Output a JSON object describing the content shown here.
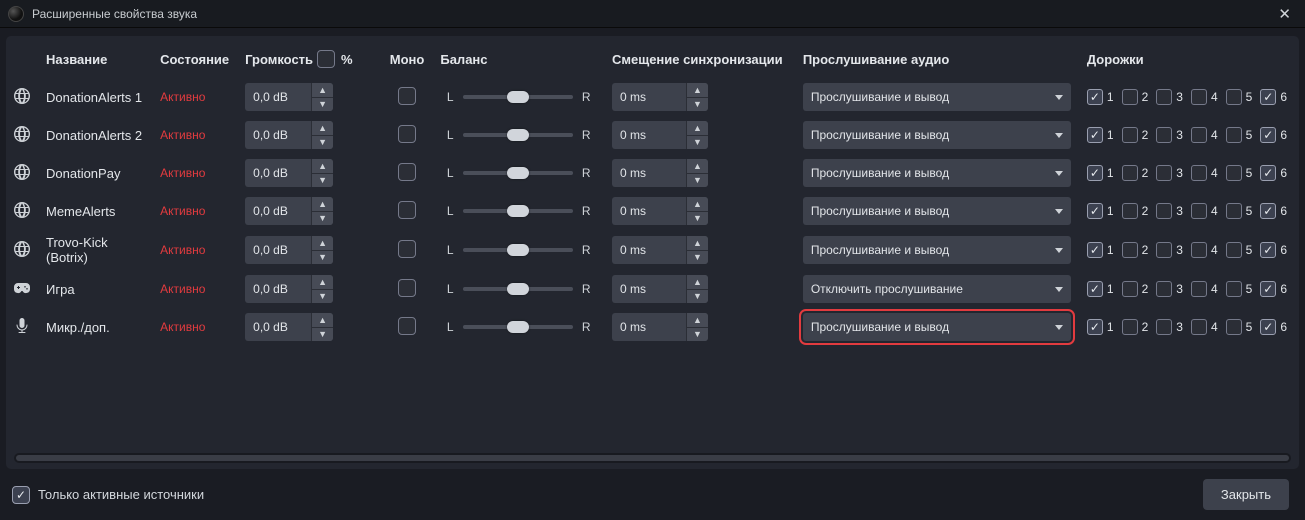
{
  "window": {
    "title": "Расширенные свойства звука"
  },
  "headers": {
    "name": "Название",
    "status": "Состояние",
    "volume": "Громкость",
    "percent": "%",
    "mono": "Моно",
    "balance": "Баланс",
    "sync_offset": "Смещение синхронизации",
    "monitoring": "Прослушивание аудио",
    "tracks": "Дорожки"
  },
  "monitoring_options": {
    "monitor_and_output": "Прослушивание и вывод",
    "monitor_off": "Отключить прослушивание"
  },
  "balance_labels": {
    "left": "L",
    "right": "R"
  },
  "rows": [
    {
      "icon": "globe",
      "name": "DonationAlerts 1",
      "status": "Активно",
      "volume": "0,0 dB",
      "mono": false,
      "sync": "0 ms",
      "monitoring": "monitor_and_output",
      "highlighted": false,
      "tracks": [
        true,
        false,
        false,
        false,
        false,
        true
      ]
    },
    {
      "icon": "globe",
      "name": "DonationAlerts 2",
      "status": "Активно",
      "volume": "0,0 dB",
      "mono": false,
      "sync": "0 ms",
      "monitoring": "monitor_and_output",
      "highlighted": false,
      "tracks": [
        true,
        false,
        false,
        false,
        false,
        true
      ]
    },
    {
      "icon": "globe",
      "name": "DonationPay",
      "status": "Активно",
      "volume": "0,0 dB",
      "mono": false,
      "sync": "0 ms",
      "monitoring": "monitor_and_output",
      "highlighted": false,
      "tracks": [
        true,
        false,
        false,
        false,
        false,
        true
      ]
    },
    {
      "icon": "globe",
      "name": "MemeAlerts",
      "status": "Активно",
      "volume": "0,0 dB",
      "mono": false,
      "sync": "0 ms",
      "monitoring": "monitor_and_output",
      "highlighted": false,
      "tracks": [
        true,
        false,
        false,
        false,
        false,
        true
      ]
    },
    {
      "icon": "globe",
      "name": "Trovo-Kick (Botrix)",
      "status": "Активно",
      "volume": "0,0 dB",
      "mono": false,
      "sync": "0 ms",
      "monitoring": "monitor_and_output",
      "highlighted": false,
      "tracks": [
        true,
        false,
        false,
        false,
        false,
        true
      ]
    },
    {
      "icon": "gamepad",
      "name": "Игра",
      "status": "Активно",
      "volume": "0,0 dB",
      "mono": false,
      "sync": "0 ms",
      "monitoring": "monitor_off",
      "highlighted": false,
      "tracks": [
        true,
        false,
        false,
        false,
        false,
        true
      ]
    },
    {
      "icon": "mic",
      "name": "Микр./доп.",
      "status": "Активно",
      "volume": "0,0 dB",
      "mono": false,
      "sync": "0 ms",
      "monitoring": "monitor_and_output",
      "highlighted": true,
      "tracks": [
        true,
        false,
        false,
        false,
        false,
        true
      ]
    }
  ],
  "footer": {
    "active_only_checked": true,
    "active_only_label": "Только активные источники",
    "close_label": "Закрыть"
  },
  "track_numbers": [
    "1",
    "2",
    "3",
    "4",
    "5",
    "6"
  ]
}
